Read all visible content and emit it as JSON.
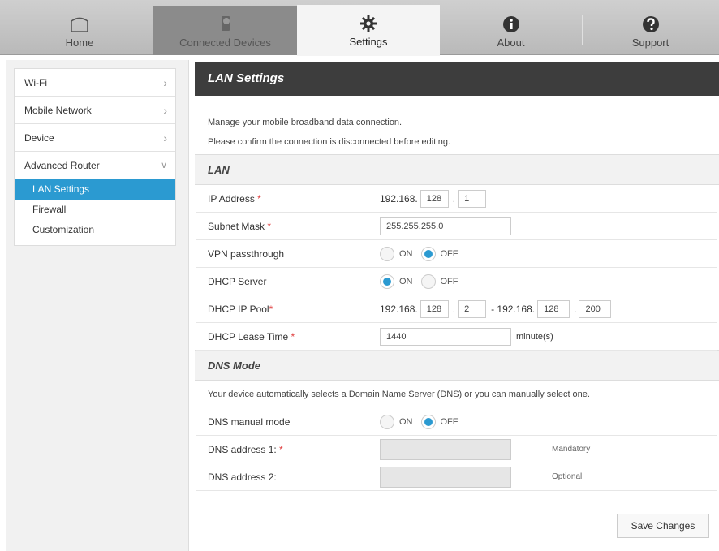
{
  "nav": {
    "tabs": [
      {
        "label": "Home",
        "icon": "home-icon"
      },
      {
        "label": "Connected Devices",
        "icon": "device-icon"
      },
      {
        "label": "Settings",
        "icon": "gear-icon",
        "active": true
      },
      {
        "label": "About",
        "icon": "info-icon"
      },
      {
        "label": "Support",
        "icon": "help-icon"
      }
    ]
  },
  "sidebar": {
    "items": [
      {
        "label": "Wi-Fi"
      },
      {
        "label": "Mobile Network"
      },
      {
        "label": "Device"
      },
      {
        "label": "Advanced Router",
        "expanded": true
      }
    ],
    "sub_items": [
      {
        "label": "LAN Settings",
        "active": true
      },
      {
        "label": "Firewall"
      },
      {
        "label": "Customization"
      }
    ]
  },
  "main": {
    "title": "LAN Settings",
    "desc1": "Manage your mobile broadband data connection.",
    "desc2": "Please confirm the connection is disconnected before editing.",
    "lan": {
      "heading": "LAN",
      "ip_label": "IP Address",
      "ip_prefix": "192.168.",
      "ip_oct3": "128",
      "ip_oct4": "1",
      "subnet_label": "Subnet Mask",
      "subnet_value": "255.255.255.0",
      "vpn_label": "VPN passthrough",
      "dhcp_label": "DHCP Server",
      "on_label": "ON",
      "off_label": "OFF",
      "pool_label": "DHCP IP Pool",
      "pool_start_prefix": "192.168.",
      "pool_start_oct3": "128",
      "pool_start_oct4": "2",
      "pool_end_prefix": "- 192.168.",
      "pool_end_oct3": "128",
      "pool_end_oct4": "200",
      "lease_label": "DHCP Lease Time",
      "lease_value": "1440",
      "lease_unit": "minute(s)",
      "required_mark": "*"
    },
    "dns": {
      "heading": "DNS Mode",
      "desc": "Your device automatically selects a Domain Name Server (DNS) or you can manually select one.",
      "manual_label": "DNS manual mode",
      "addr1_label": "DNS address 1:",
      "addr1_hint": "Mandatory",
      "addr2_label": "DNS address 2:",
      "addr2_hint": "Optional"
    },
    "save_label": "Save Changes"
  },
  "colors": {
    "accent": "#2b9ad1",
    "header_bg": "#3d3d3d",
    "required": "#e04040"
  }
}
